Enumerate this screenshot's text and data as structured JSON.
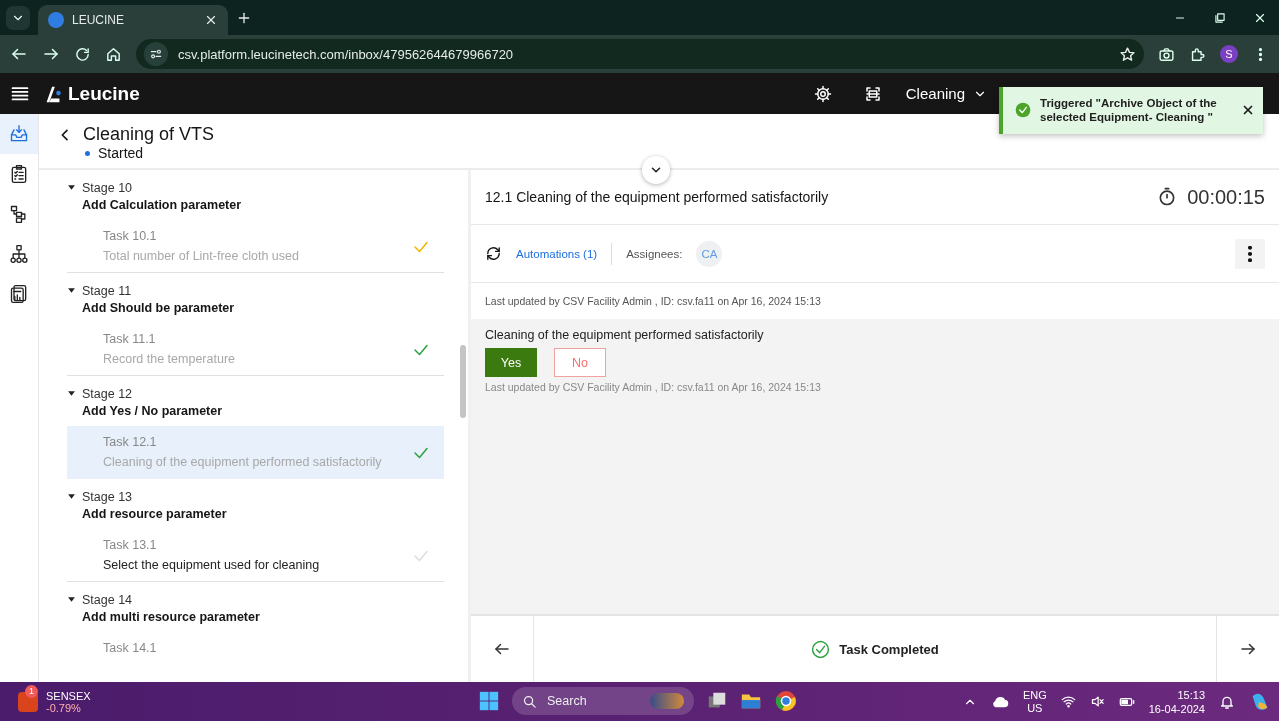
{
  "browser": {
    "tabs": [
      {
        "title": "LEUCINE",
        "selected": true
      }
    ],
    "url": "csv.platform.leucinetech.com/inbox/479562644679966720",
    "profile": "S"
  },
  "app": {
    "brand": "Leucine",
    "menu": "Cleaning"
  },
  "nav_items": [
    {
      "kind": "inbox",
      "selected": true
    },
    {
      "kind": "checklist",
      "selected": false
    },
    {
      "kind": "flow",
      "selected": false
    },
    {
      "kind": "hierarchy",
      "selected": false
    },
    {
      "kind": "reports",
      "selected": false
    }
  ],
  "toast": {
    "message": "Triggered \"Archive Object of the selected Equipment- Cleaning \""
  },
  "job": {
    "title": "Cleaning of VTS",
    "status": "Started"
  },
  "stages": [
    {
      "stage": "Stage 10",
      "name": "Add Calculation parameter",
      "expanded": true,
      "tasks": [
        {
          "number": "Task 10.1",
          "name": "Total number of Lint-free cloth used",
          "color": "#f2b400",
          "completed": true,
          "selected": false
        }
      ]
    },
    {
      "stage": "Stage 11",
      "name": "Add Should be parameter",
      "expanded": true,
      "tasks": [
        {
          "number": "Task 11.1",
          "name": "Record the temperature",
          "color": "#2da042",
          "completed": true,
          "selected": false
        }
      ]
    },
    {
      "stage": "Stage 12",
      "name": "Add Yes / No parameter",
      "expanded": true,
      "tasks": [
        {
          "number": "Task 12.1",
          "name": "Cleaning of the equipment performed satisfactorily",
          "color": "#2da042",
          "completed": true,
          "selected": true
        }
      ]
    },
    {
      "stage": "Stage 13",
      "name": "Add resource parameter",
      "expanded": true,
      "tasks": [
        {
          "number": "Task 13.1",
          "name": "Select the equipment used for cleaning",
          "color": "#dcdcdc",
          "completed": false,
          "selected": false
        }
      ]
    },
    {
      "stage": "Stage 14",
      "name": "Add multi resource parameter",
      "expanded": true,
      "tasks": [
        {
          "number": "Task 14.1"
        }
      ]
    }
  ],
  "task": {
    "title": "12.1 Cleaning of the equipment performed satisfactorily",
    "timer": "00:00:15",
    "automations": "Automations (1)",
    "assignees_label": "Assignees:",
    "assignees": [
      "CA"
    ],
    "last_updated": "Last updated by CSV Facility Admin , ID: csv.fa11 on Apr 16, 2024 15:13",
    "parameter": {
      "label": "Cleaning of the equipment performed satisfactorily",
      "options": [
        {
          "label": "Yes",
          "selected": true
        },
        {
          "label": "No",
          "selected": false
        }
      ],
      "last_updated": "Last updated by CSV Facility Admin , ID: csv.fa11 on Apr 16, 2024 15:13"
    },
    "completion": "Task Completed"
  },
  "taskbar": {
    "widget": {
      "badge": "1",
      "title": "SENSEX",
      "value": "-0.79%"
    },
    "search_placeholder": "Search",
    "language": "ENG",
    "region": "US",
    "time": "15:13",
    "date": "16-04-2024"
  }
}
